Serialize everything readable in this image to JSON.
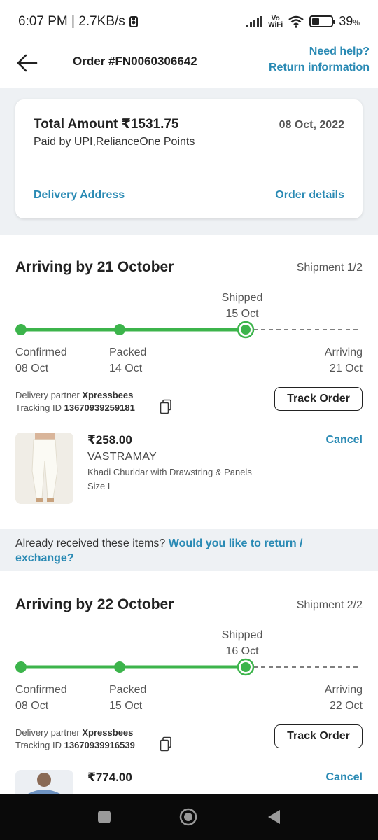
{
  "status_bar": {
    "time_speed": "6:07 PM | 2.7KB/s",
    "vowifi_top": "Vo",
    "vowifi_bottom": "WiFi",
    "battery_percent": "39",
    "battery_unit": "%",
    "battery_level": 0.39
  },
  "header": {
    "order_title": "Order #FN0060306642",
    "help_link": "Need help?",
    "return_link": "Return information"
  },
  "summary": {
    "total_amount": "Total Amount ₹1531.75",
    "paid_by": "Paid by UPI,RelianceOne Points",
    "date": "08 Oct, 2022",
    "delivery_address_link": "Delivery Address",
    "order_details_link": "Order details"
  },
  "shipments": [
    {
      "title": "Arriving by 21 October",
      "count": "Shipment 1/2",
      "shipped_label": "Shipped",
      "shipped_date": "15 Oct",
      "steps": [
        {
          "label": "Confirmed",
          "date": "08 Oct"
        },
        {
          "label": "Packed",
          "date": "14 Oct"
        },
        {
          "label": "Arriving",
          "date": "21 Oct"
        }
      ],
      "partner_prefix": "Delivery partner",
      "partner_name": "Xpressbees",
      "tracking_prefix": "Tracking ID",
      "tracking_id": "13670939259181",
      "track_button": "Track Order",
      "item": {
        "price": "₹258.00",
        "brand": "VASTRAMAY",
        "name": "Khadi Churidar with Drawstring & Panels",
        "size": "Size L",
        "cancel": "Cancel"
      }
    },
    {
      "title": "Arriving by 22 October",
      "count": "Shipment 2/2",
      "shipped_label": "Shipped",
      "shipped_date": "16 Oct",
      "steps": [
        {
          "label": "Confirmed",
          "date": "08 Oct"
        },
        {
          "label": "Packed",
          "date": "15 Oct"
        },
        {
          "label": "Arriving",
          "date": "22 Oct"
        }
      ],
      "partner_prefix": "Delivery partner",
      "partner_name": "Xpressbees",
      "tracking_prefix": "Tracking ID",
      "tracking_id": "13670939916539",
      "track_button": "Track Order",
      "item": {
        "price": "₹774.00",
        "cancel": "Cancel"
      }
    }
  ],
  "return_prompt": {
    "question": "Already received these items?",
    "link": "Would you like to return / exchange?"
  },
  "colors": {
    "accent": "#2a8ab4",
    "progress": "#3cb44b",
    "band": "#eef1f4"
  },
  "icons": {
    "back": "arrow-left",
    "copy": "copy",
    "nav": [
      "square-recents",
      "circle-home",
      "triangle-back"
    ]
  }
}
